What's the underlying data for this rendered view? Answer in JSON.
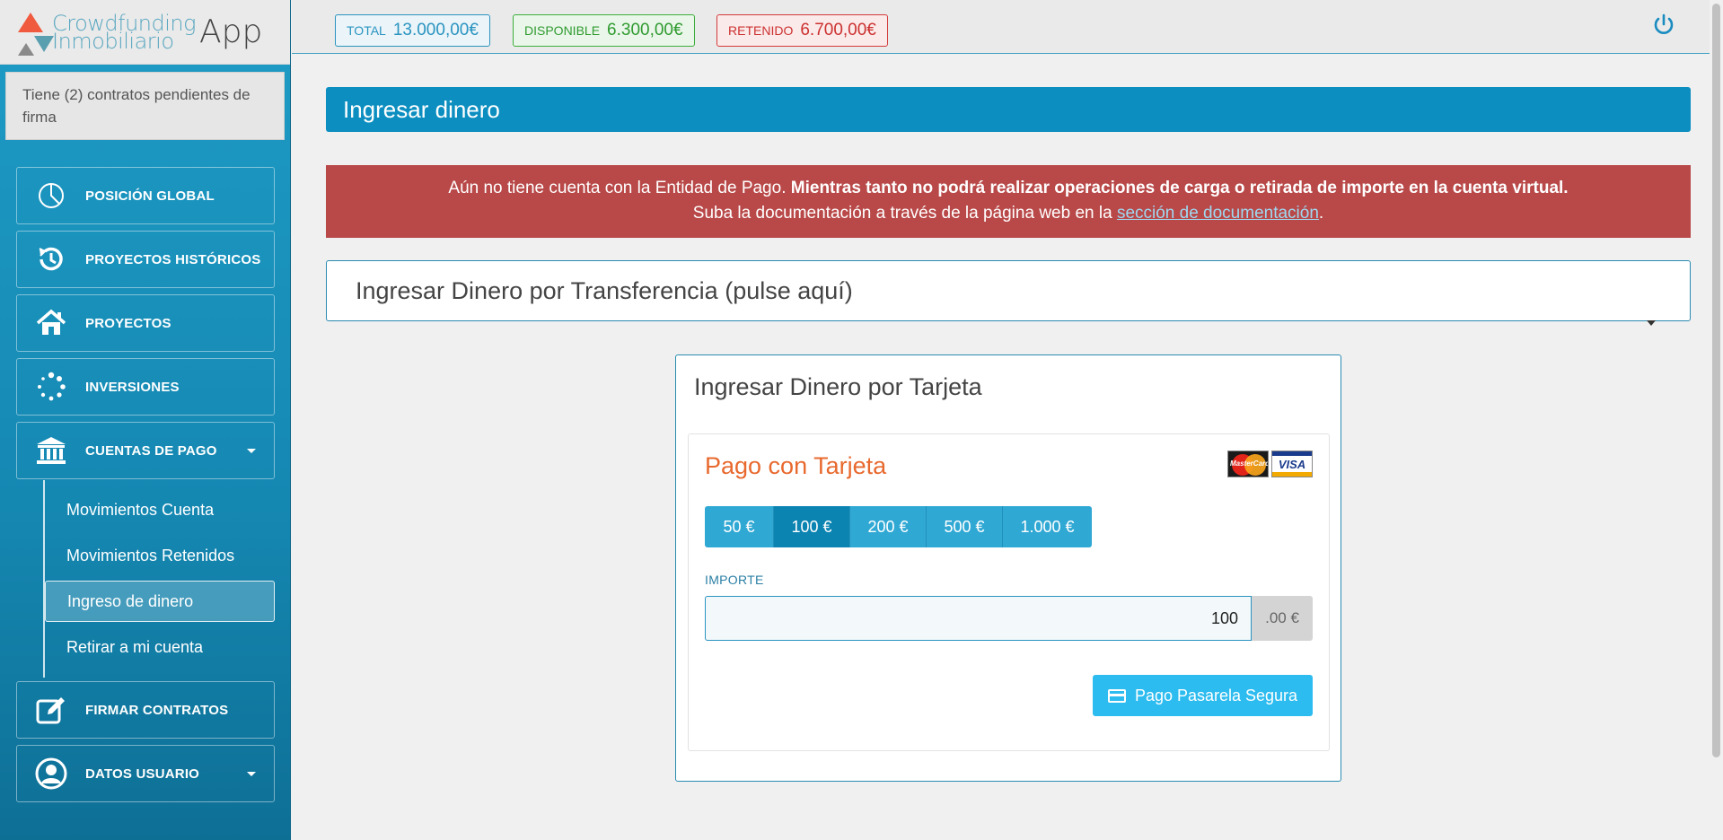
{
  "logo": {
    "line1": "Crowdfunding",
    "line2": "Inmobiliario",
    "app": "App"
  },
  "pending": {
    "text": "Tiene (2) contratos pendientes de firma"
  },
  "nav": {
    "items": [
      {
        "label": "POSICIÓN GLOBAL",
        "icon": "pie-chart-icon"
      },
      {
        "label": "PROYECTOS HISTÓRICOS",
        "icon": "history-icon"
      },
      {
        "label": "PROYECTOS",
        "icon": "home-icon"
      },
      {
        "label": "INVERSIONES",
        "icon": "spinner-icon"
      },
      {
        "label": "CUENTAS DE PAGO",
        "icon": "bank-icon"
      },
      {
        "label": "FIRMAR CONTRATOS",
        "icon": "edit-icon"
      },
      {
        "label": "DATOS USUARIO",
        "icon": "user-circle-icon"
      }
    ],
    "subitems": [
      {
        "label": "Movimientos Cuenta"
      },
      {
        "label": "Movimientos Retenidos"
      },
      {
        "label": "Ingreso de dinero"
      },
      {
        "label": "Retirar a mi cuenta"
      }
    ]
  },
  "topbar": {
    "total_label": "TOTAL",
    "total_value": "13.000,00€",
    "disp_label": "DISPONIBLE",
    "disp_value": "6.300,00€",
    "ret_label": "RETENIDO",
    "ret_value": "6.700,00€",
    "colors": {
      "total": "#2a94c0",
      "disp": "#2f9b2f",
      "ret": "#cc3030"
    }
  },
  "main": {
    "title": "Ingresar dinero",
    "alert": {
      "part1": "Aún no tiene cuenta con la Entidad de Pago. ",
      "bold": "Mientras tanto no podrá realizar operaciones de carga o retirada de importe en la cuenta virtual.",
      "part2": "Suba la documentación a través de la página web en la ",
      "link": "sección de documentación",
      "part3": "."
    },
    "transfer": "Ingresar Dinero por Transferencia (pulse aquí)",
    "card": {
      "title": "Ingresar Dinero por Tarjeta",
      "pago_title": "Pago con Tarjeta",
      "amounts": [
        "50 €",
        "100 €",
        "200 €",
        "500 €",
        "1.000 €"
      ],
      "selected_amount": "100 €",
      "importe_label": "IMPORTE",
      "importe_value": "100",
      "importe_suffix": ".00 €",
      "pay_button": "Pago Pasarela Segura",
      "mastercard_text": "MasterCard",
      "visa_text": "VISA"
    }
  }
}
